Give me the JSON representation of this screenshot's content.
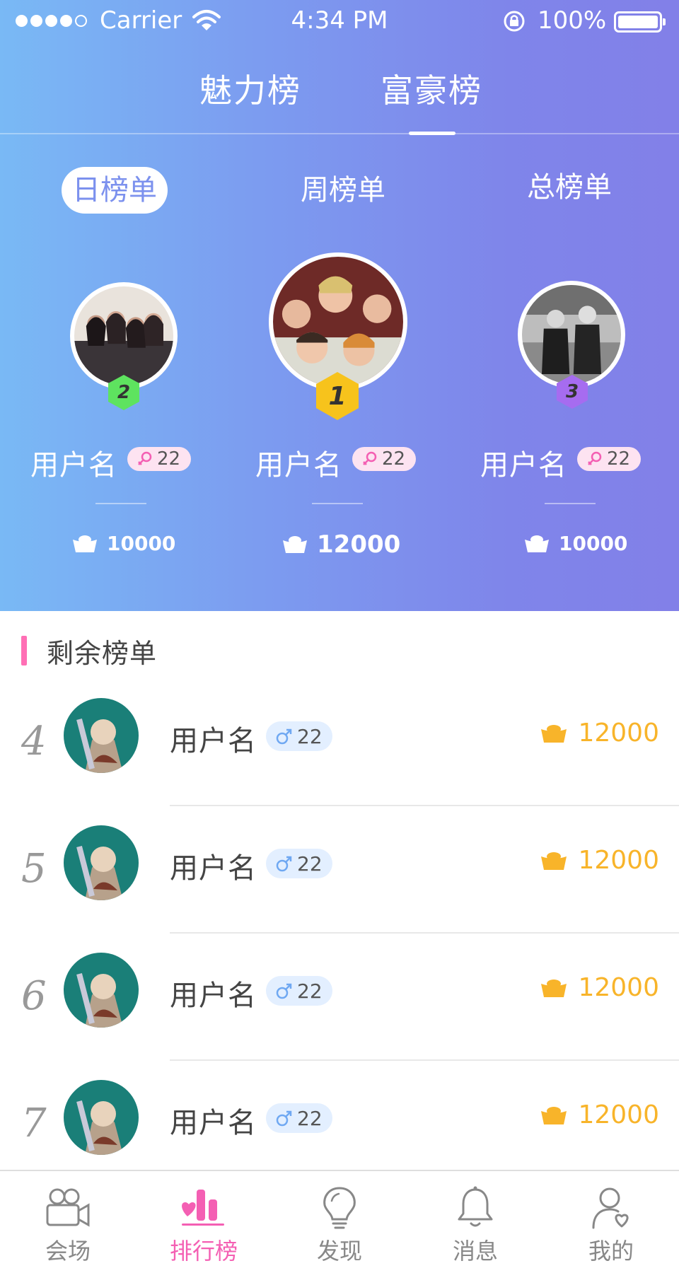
{
  "status_bar": {
    "carrier": "Carrier",
    "time": "4:34 PM",
    "battery": "100%"
  },
  "top_tabs": [
    {
      "label": "魅力榜"
    },
    {
      "label": "富豪榜"
    }
  ],
  "period_tabs": [
    {
      "label": "日榜单"
    },
    {
      "label": "周榜单"
    },
    {
      "label": "总榜单"
    }
  ],
  "podium": [
    {
      "rank": "2",
      "name": "用户名",
      "age": "22",
      "coins": "10000",
      "gender": "female",
      "badge_color": "#5ee35f"
    },
    {
      "rank": "1",
      "name": "用户名",
      "age": "22",
      "coins": "12000",
      "gender": "female",
      "badge_color": "#f7c31c"
    },
    {
      "rank": "3",
      "name": "用户名",
      "age": "22",
      "coins": "10000",
      "gender": "female",
      "badge_color": "#a66cf0"
    }
  ],
  "section": {
    "title": "剩余榜单"
  },
  "list": [
    {
      "rank": "4",
      "name": "用户名",
      "age": "22",
      "coins": "12000",
      "gender": "male"
    },
    {
      "rank": "5",
      "name": "用户名",
      "age": "22",
      "coins": "12000",
      "gender": "male"
    },
    {
      "rank": "6",
      "name": "用户名",
      "age": "22",
      "coins": "12000",
      "gender": "male"
    },
    {
      "rank": "7",
      "name": "用户名",
      "age": "22",
      "coins": "12000",
      "gender": "male"
    }
  ],
  "tab_bar": [
    {
      "label": "会场",
      "icon": "video-camera-icon"
    },
    {
      "label": "排行榜",
      "icon": "ranking-chart-icon",
      "active": true
    },
    {
      "label": "发现",
      "icon": "lightbulb-icon"
    },
    {
      "label": "消息",
      "icon": "bell-icon"
    },
    {
      "label": "我的",
      "icon": "user-heart-icon"
    }
  ],
  "colors": {
    "accent_pink": "#f45fb3",
    "gold": "#f8b42a",
    "gradient_left": "#79b9f5",
    "gradient_right": "#8280e8"
  }
}
